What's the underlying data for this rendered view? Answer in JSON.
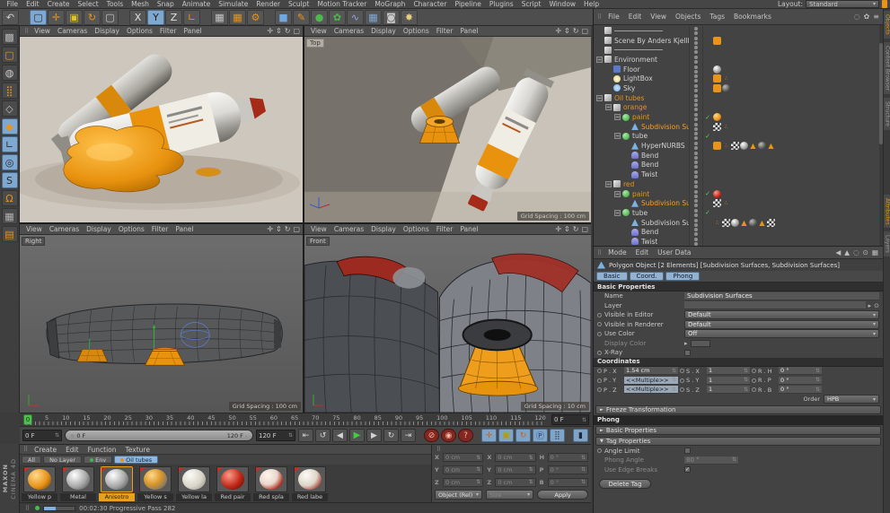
{
  "glyphs": {
    "grip": "⠿",
    "caret": "▾",
    "stepper": "⇅",
    "arrow_right": "▸",
    "check": "✓",
    "handle": "●",
    "circle": "⊙",
    "fold_closed": "►",
    "fold_open": "▼",
    "minus": "−"
  },
  "menubar": {
    "items": [
      "File",
      "Edit",
      "Create",
      "Select",
      "Tools",
      "Mesh",
      "Snap",
      "Animate",
      "Simulate",
      "Render",
      "Sculpt",
      "Motion Tracker",
      "MoGraph",
      "Character",
      "Pipeline",
      "Plugins",
      "Script",
      "Window",
      "Help"
    ],
    "layout_label": "Layout:",
    "layout_value": "Standard"
  },
  "main_toolbar": {
    "icons": [
      {
        "g": "↶",
        "c": "#d0d0d0",
        "n": "undo-icon"
      },
      {
        "k": "gap"
      },
      {
        "g": "▢",
        "c": "#2a2a2a",
        "k": "sel",
        "n": "live-selection-icon"
      },
      {
        "g": "✛",
        "c": "#e8941a",
        "n": "move-tool-icon"
      },
      {
        "g": "▣",
        "c": "#e3c41e",
        "n": "scale-tool-icon"
      },
      {
        "g": "↻",
        "c": "#e8941a",
        "n": "rotate-tool-icon"
      },
      {
        "g": "▢",
        "c": "#c8c8c8",
        "n": "last-tool-icon"
      },
      {
        "k": "gap"
      },
      {
        "g": "X",
        "c": "#e0e0e0",
        "n": "x-axis-lock-icon"
      },
      {
        "g": "Y",
        "c": "#222222",
        "k": "sel",
        "n": "y-axis-lock-icon"
      },
      {
        "g": "Z",
        "c": "#e0e0e0",
        "n": "z-axis-lock-icon"
      },
      {
        "g": "∟",
        "c": "#e8941a",
        "n": "coord-system-icon"
      },
      {
        "k": "gap"
      },
      {
        "g": "▦",
        "c": "#c8c8c8",
        "n": "render-view-icon"
      },
      {
        "g": "▦",
        "c": "#e8941a",
        "n": "render-active-view-icon"
      },
      {
        "g": "⚙",
        "c": "#e8941a",
        "n": "render-settings-icon"
      },
      {
        "k": "gap"
      },
      {
        "g": "■",
        "c": "#6fa8e0",
        "n": "add-cube-icon"
      },
      {
        "g": "✎",
        "c": "#e8941a",
        "n": "spline-pen-icon"
      },
      {
        "g": "●",
        "c": "#4db84d",
        "n": "subdivision-surface-icon"
      },
      {
        "g": "✿",
        "c": "#4db84d",
        "n": "deformer-icon"
      },
      {
        "g": "∿",
        "c": "#8fa8e8",
        "n": "spline-primitive-icon"
      },
      {
        "g": "▦",
        "c": "#7fa8d8",
        "n": "floor-object-icon"
      },
      {
        "g": "◙",
        "c": "#c8c8c8",
        "n": "camera-icon"
      },
      {
        "g": "✸",
        "c": "#e8d080",
        "n": "light-icon"
      }
    ]
  },
  "left_toolbar": {
    "icons": [
      {
        "g": "▩",
        "c": "#b8b8b8",
        "n": "make-editable-icon"
      },
      {
        "g": "▢",
        "c": "#e8941a",
        "n": "model-mode-icon"
      },
      {
        "g": "◍",
        "c": "#cccccc",
        "n": "texture-mode-icon"
      },
      {
        "g": "⣿",
        "c": "#e8941a",
        "n": "point-mode-icon"
      },
      {
        "g": "◇",
        "c": "#c0c0c0",
        "n": "edge-mode-icon"
      },
      {
        "g": "◆",
        "c": "#e8941a",
        "k": "sel",
        "n": "polygon-mode-icon"
      },
      {
        "g": "∟",
        "c": "#2a2a2a",
        "k": "sel",
        "n": "object-axis-mode-icon"
      },
      {
        "g": "◎",
        "c": "#2a2a2a",
        "k": "sel",
        "n": "viewport-solo-icon"
      },
      {
        "g": "S",
        "c": "#2a2a2a",
        "k": "sel",
        "n": "snap-icon"
      },
      {
        "g": "Ω",
        "c": "#e8941a",
        "n": "magnet-snap-icon"
      },
      {
        "g": "▦",
        "c": "#b0b0b0",
        "n": "workplane-icon"
      },
      {
        "g": "▤",
        "c": "#e8941a",
        "n": "workplane-lock-icon"
      }
    ]
  },
  "viewports": {
    "menu": [
      "View",
      "Cameras",
      "Display",
      "Options",
      "Filter",
      "Panel"
    ],
    "nav": [
      {
        "g": "✛",
        "n": "pan-view-icon"
      },
      {
        "g": "⇕",
        "n": "dolly-view-icon"
      },
      {
        "g": "↻",
        "n": "rotate-view-icon"
      },
      {
        "g": "▢",
        "n": "toggle-view-icon"
      }
    ],
    "top_right_label": "Top",
    "bottom_left_label": "Right",
    "bottom_right_label": "Front",
    "grid_100": "Grid Spacing : 100 cm",
    "grid_10": "Grid Spacing : 10 cm"
  },
  "object_manager": {
    "menu": [
      "File",
      "Edit",
      "View",
      "Objects",
      "Tags",
      "Bookmarks"
    ],
    "icons": [
      {
        "g": "◌",
        "n": "search-icon"
      },
      {
        "g": "✿",
        "n": "filter-icon"
      },
      {
        "g": "≡",
        "n": "panel-menu-icon"
      }
    ],
    "rows": [
      {
        "expcls": "off",
        "icon": "ic-null",
        "name": "────────────",
        "dcls": "gg",
        "ind": "ind0",
        "tags": []
      },
      {
        "expcls": "off",
        "icon": "ic-null",
        "name": "Scene By Anders Kjellberg",
        "dcls": "gg",
        "ind": "ind0",
        "tags": [
          {
            "k": "note",
            "n": "annotation-tag-icon"
          }
        ]
      },
      {
        "expcls": "off",
        "icon": "ic-null",
        "name": "────────────",
        "dcls": "gg",
        "ind": "ind0",
        "tags": []
      },
      {
        "exp": "−",
        "expcls": "on",
        "icon": "ic-null",
        "name": "Environment",
        "dcls": "gg",
        "ind": "ind0",
        "tags": []
      },
      {
        "expcls": "off",
        "icon": "ic-floor",
        "name": "Floor",
        "dcls": "gg",
        "ind": "ind1",
        "tags": [
          {
            "k": "mat-gray",
            "n": "material-tag-icon"
          }
        ]
      },
      {
        "expcls": "off",
        "icon": "ic-light",
        "name": "LightBox",
        "dcls": "gg",
        "ind": "ind1",
        "tags": [
          {
            "k": "note",
            "n": "target-tag-icon"
          },
          {
            "k": "odots",
            "g": "∴",
            "n": "expression-tag-icon"
          }
        ]
      },
      {
        "expcls": "off",
        "icon": "ic-sky",
        "name": "Sky",
        "dcls": "gg",
        "ind": "ind1",
        "tags": [
          {
            "k": "note",
            "n": "compositing-tag-icon"
          },
          {
            "k": "mat-dark",
            "n": "material-tag-icon"
          }
        ]
      },
      {
        "exp": "−",
        "expcls": "on",
        "icon": "ic-null",
        "name": "Oil tubes",
        "ncls": "orange",
        "dcls": "gg",
        "ind": "ind0",
        "tags": []
      },
      {
        "exp": "−",
        "expcls": "on",
        "icon": "ic-null",
        "name": "orange",
        "ncls": "orange",
        "dcls": "gg",
        "ind": "ind1",
        "tags": []
      },
      {
        "exp": "−",
        "expcls": "on",
        "icon": "ic-poly",
        "name": "paint",
        "ncls": "orange",
        "dcls": "gg",
        "chk": "✓",
        "ind": "ind2",
        "tags": [
          {
            "k": "mat-orange",
            "n": "material-tag-icon"
          }
        ]
      },
      {
        "expcls": "off",
        "icon": "ic-sds",
        "name": "Subdivision Surfaces",
        "ncls": "sel",
        "dcls": "gg",
        "ind": "ind3",
        "tags": [
          {
            "k": "checker",
            "n": "sds-weight-tag-icon"
          },
          {
            "k": "odots",
            "g": "∴",
            "n": "dots-tag-icon"
          }
        ]
      },
      {
        "exp": "−",
        "expcls": "on",
        "icon": "ic-poly",
        "name": "tube",
        "dcls": "gg",
        "chk": "✓",
        "ind": "ind2",
        "tags": []
      },
      {
        "expcls": "off",
        "icon": "ic-sds",
        "name": "HyperNURBS",
        "dcls": "gg",
        "ind": "ind3",
        "tags": [
          {
            "k": "note",
            "n": "texture-tag-icon"
          },
          {
            "k": "odots",
            "g": "∴",
            "n": "dots-tag-icon"
          },
          {
            "k": "checker",
            "n": "sds-weight-tag-icon"
          },
          {
            "k": "mat-gray",
            "n": "material-tag-icon"
          },
          {
            "k": "tri",
            "g": "▲",
            "n": "phong-tag-icon"
          },
          {
            "k": "mat-dark",
            "n": "material-tag-icon"
          },
          {
            "k": "tri",
            "g": "▲",
            "n": "phong-tag-icon"
          }
        ]
      },
      {
        "expcls": "off",
        "icon": "ic-bend",
        "name": "Bend",
        "dcls": "rg",
        "ind": "ind3",
        "tags": []
      },
      {
        "expcls": "off",
        "icon": "ic-bend",
        "name": "Bend",
        "dcls": "rg",
        "ind": "ind3",
        "tags": []
      },
      {
        "expcls": "off",
        "icon": "ic-twist",
        "name": "Twist",
        "dcls": "rg",
        "ind": "ind3",
        "tags": []
      },
      {
        "exp": "−",
        "expcls": "on",
        "icon": "ic-null",
        "name": "red",
        "ncls": "orange",
        "dcls": "gg",
        "ind": "ind1",
        "tags": []
      },
      {
        "exp": "−",
        "expcls": "on",
        "icon": "ic-poly",
        "name": "paint",
        "ncls": "orange",
        "dcls": "gg",
        "chk": "✓",
        "ind": "ind2",
        "tags": [
          {
            "k": "mat-red",
            "n": "material-tag-icon"
          }
        ]
      },
      {
        "expcls": "off",
        "icon": "ic-sds",
        "name": "Subdivision Surfaces",
        "ncls": "sel",
        "dcls": "gg",
        "ind": "ind3",
        "tags": [
          {
            "k": "checker",
            "n": "sds-weight-tag-icon"
          },
          {
            "k": "odots",
            "g": "∴",
            "n": "dots-tag-icon"
          }
        ]
      },
      {
        "exp": "−",
        "expcls": "on",
        "icon": "ic-poly",
        "name": "tube",
        "dcls": "gg",
        "chk": "✓",
        "ind": "ind2",
        "tags": []
      },
      {
        "expcls": "off",
        "icon": "ic-sds",
        "name": "Subdivision Surfaces",
        "dcls": "gg",
        "ind": "ind3",
        "tags": [
          {
            "k": "odots",
            "g": "∴",
            "n": "dots-tag-icon"
          },
          {
            "k": "checker",
            "n": "sds-weight-tag-icon"
          },
          {
            "k": "mat-gray",
            "n": "material-tag-icon"
          },
          {
            "k": "tri",
            "g": "▲",
            "n": "phong-tag-icon"
          },
          {
            "k": "mat-dark",
            "n": "material-tag-icon"
          },
          {
            "k": "tri",
            "g": "▲",
            "n": "phong-tag-icon"
          },
          {
            "k": "checker",
            "n": "uv-tag-icon"
          }
        ]
      },
      {
        "expcls": "off",
        "icon": "ic-bend",
        "name": "Bend",
        "dcls": "rg",
        "ind": "ind3",
        "tags": []
      },
      {
        "expcls": "off",
        "icon": "ic-twist",
        "name": "Twist",
        "dcls": "rg",
        "ind": "ind3",
        "tags": []
      }
    ]
  },
  "attributes": {
    "menu": [
      "Mode",
      "Edit",
      "User Data"
    ],
    "icons": [
      {
        "g": "◀",
        "n": "history-back-icon"
      },
      {
        "g": "▲",
        "n": "history-forward-icon"
      },
      {
        "g": "◌",
        "n": "search-icon"
      },
      {
        "g": "⊙",
        "n": "lock-icon"
      },
      {
        "g": "▦",
        "n": "panel-options-icon"
      }
    ],
    "title": "Polygon Object [2 Elements] [Subdivision Surfaces, Subdivision Surfaces]",
    "tabs": [
      "Basic",
      "Coord.",
      "Phong"
    ],
    "basic_header": "Basic Properties",
    "name_label": "Name",
    "name_value": "Subdivision Surfaces",
    "layer_label": "Layer",
    "ve_label": "Visible in Editor",
    "ve_value": "Default",
    "vr_label": "Visible in Renderer",
    "vr_value": "Default",
    "uc_label": "Use Color",
    "uc_value": "Off",
    "dc_label": "Display Color",
    "xray_label": "X-Ray",
    "coord_header": "Coordinates",
    "c1": {
      "l1": "P . X",
      "v1": "1.54 cm",
      "l2": "S . X",
      "v2": "1",
      "l3": "R . H",
      "v3": "0 °"
    },
    "c2": {
      "l1": "P . Y",
      "v1": "<<Multiple>>",
      "l2": "S . Y",
      "v2": "1",
      "l3": "R . P",
      "v3": "0 °"
    },
    "c3": {
      "l1": "P . Z",
      "v1": "<<Multiple>>",
      "l2": "S . Z",
      "v2": "1",
      "l3": "R . B",
      "v3": "0 °"
    },
    "order_label": "Order",
    "order_value": "HPB",
    "freeze_label": "Freeze Transformation",
    "phong_header": "Phong",
    "phong_basic_label": "Basic Properties",
    "tag_props_label": "Tag Properties",
    "angle_label": "Angle Limit",
    "phong_angle_label": "Phong Angle",
    "phong_angle_value": "80 °",
    "edge_label": "Use Edge Breaks",
    "edge_check": "✓",
    "delete_label": "Delete Tag"
  },
  "timeline": {
    "ticks": [
      "0",
      "5",
      "10",
      "15",
      "20",
      "25",
      "30",
      "35",
      "40",
      "45",
      "50",
      "55",
      "60",
      "65",
      "70",
      "75",
      "80",
      "85",
      "90",
      "95",
      "100",
      "105",
      "110",
      "115",
      "120"
    ],
    "playhead": "0",
    "current": "0 F",
    "range_start": "0 F",
    "range_end": "120 F",
    "end": "120 F"
  },
  "transport": {
    "icons": [
      {
        "g": "⇤",
        "n": "goto-start-icon"
      },
      {
        "g": "↺",
        "n": "play-backwards-icon"
      },
      {
        "g": "◀",
        "n": "previous-frame-icon"
      },
      {
        "g": "▶",
        "k": "play",
        "n": "play-forwards-icon"
      },
      {
        "g": "▶",
        "n": "next-frame-icon"
      },
      {
        "g": "↻",
        "n": "play-loop-icon"
      },
      {
        "g": "⇥",
        "n": "goto-end-icon"
      },
      {
        "k": "gap"
      },
      {
        "g": "⊘",
        "k": "rec",
        "n": "record-keyframe-icon"
      },
      {
        "g": "◉",
        "k": "rec",
        "n": "autokeying-icon"
      },
      {
        "g": "?",
        "k": "rec",
        "n": "keyframe-selection-icon"
      },
      {
        "k": "gap"
      },
      {
        "g": "✛",
        "k": "hl o",
        "n": "record-position-icon"
      },
      {
        "g": "▣",
        "k": "hl y",
        "n": "record-scale-icon"
      },
      {
        "g": "↻",
        "k": "hl o",
        "n": "record-rotation-icon"
      },
      {
        "g": "Ⓟ",
        "k": "hl b",
        "n": "record-parameter-icon"
      },
      {
        "g": "⣿",
        "k": "hl g2",
        "n": "record-pla-icon"
      },
      {
        "k": "gap"
      },
      {
        "g": "▮",
        "k": "hl",
        "n": "keyframe-presets-icon"
      }
    ]
  },
  "materials": {
    "menu": [
      "Create",
      "Edit",
      "Function",
      "Texture"
    ],
    "tabs": [
      {
        "label": "All",
        "cls": "",
        "dotcls": "",
        "dot": ""
      },
      {
        "label": "No Layer",
        "cls": "",
        "dotcls": "",
        "dot": ""
      },
      {
        "label": "Env",
        "cls": "",
        "dotcls": "dot-on",
        "dot": "#45b24e"
      },
      {
        "label": "Oil tubes",
        "cls": "sel",
        "dotcls": "dot-on",
        "dot": "#e8941a"
      }
    ],
    "items": [
      {
        "name": "Yellow p",
        "mcls": "m-orange",
        "lcls": "",
        "tcls": ""
      },
      {
        "name": "Metal",
        "mcls": "m-silver",
        "lcls": "",
        "tcls": ""
      },
      {
        "name": "Anisotro",
        "mcls": "m-silver",
        "lcls": "lsel",
        "tcls": "tsel"
      },
      {
        "name": "Yellow s",
        "mcls": "m-orangemix",
        "lcls": "",
        "tcls": ""
      },
      {
        "name": "Yellow la",
        "mcls": "m-white",
        "lcls": "",
        "tcls": ""
      },
      {
        "name": "Red pair",
        "mcls": "m-red",
        "lcls": "",
        "tcls": ""
      },
      {
        "name": "Red spla",
        "mcls": "m-redsplash",
        "lcls": "",
        "tcls": ""
      },
      {
        "name": "Red labe",
        "mcls": "m-redlabel",
        "lcls": "",
        "tcls": ""
      }
    ]
  },
  "coords_panel": {
    "cells": [
      {
        "l": "X",
        "v": "0 cm"
      },
      {
        "l": "X",
        "v": "0 cm"
      },
      {
        "l": "H",
        "v": "0 °"
      },
      {
        "l": "Y",
        "v": "0 cm"
      },
      {
        "l": "Y",
        "v": "0 cm"
      },
      {
        "l": "P",
        "v": "0 °"
      },
      {
        "l": "Z",
        "v": "0 cm"
      },
      {
        "l": "Z",
        "v": "0 cm"
      },
      {
        "l": "B",
        "v": "0 °"
      }
    ],
    "mode": "Object (Rel)",
    "size": "Size",
    "apply": "Apply"
  },
  "status": {
    "text": "00:02:30 Progressive Pass 282"
  },
  "brand": {
    "line1": "MAXON",
    "line2": "CINEMA 4D"
  },
  "right_tabs": {
    "top": [
      {
        "label": "Objects",
        "k": "sel"
      },
      {
        "label": "Content Browser",
        "k": ""
      },
      {
        "label": "Structure",
        "k": ""
      }
    ],
    "bottom": [
      {
        "label": "Attributes",
        "k": "sel"
      },
      {
        "label": "Layers",
        "k": ""
      }
    ]
  }
}
